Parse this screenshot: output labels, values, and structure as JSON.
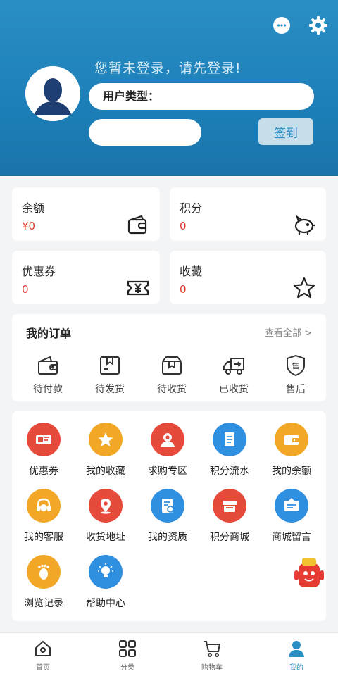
{
  "header": {
    "login_hint": "您暂未登录，请先登录!",
    "user_type_label": "用户类型：",
    "signin_label": "签到"
  },
  "stats": [
    {
      "title": "余额",
      "value": "¥0",
      "icon": "wallet-icon"
    },
    {
      "title": "积分",
      "value": "0",
      "icon": "piggy-bank-icon"
    },
    {
      "title": "优惠券",
      "value": "0",
      "icon": "ticket-icon"
    },
    {
      "title": "收藏",
      "value": "0",
      "icon": "star-icon"
    }
  ],
  "orders": {
    "title": "我的订单",
    "view_all": "查看全部 >",
    "items": [
      {
        "label": "待付款",
        "icon": "wallet-icon"
      },
      {
        "label": "待发货",
        "icon": "box-icon"
      },
      {
        "label": "待收货",
        "icon": "open-box-icon"
      },
      {
        "label": "已收货",
        "icon": "truck-icon"
      },
      {
        "label": "售后",
        "icon": "shield-icon"
      }
    ]
  },
  "services": [
    {
      "label": "优惠券",
      "icon": "coupon-icon",
      "color": "#e64a3a"
    },
    {
      "label": "我的收藏",
      "icon": "star-icon",
      "color": "#f2a826"
    },
    {
      "label": "求购专区",
      "icon": "person-icon",
      "color": "#e64a3a"
    },
    {
      "label": "积分流水",
      "icon": "list-icon",
      "color": "#2f8fe0"
    },
    {
      "label": "我的余额",
      "icon": "wallet-icon",
      "color": "#f2a826"
    },
    {
      "label": "我的客服",
      "icon": "headset-icon",
      "color": "#f2a826"
    },
    {
      "label": "收货地址",
      "icon": "location-icon",
      "color": "#e64a3a"
    },
    {
      "label": "我的资质",
      "icon": "document-icon",
      "color": "#2f8fe0"
    },
    {
      "label": "积分商城",
      "icon": "store-icon",
      "color": "#e64a3a"
    },
    {
      "label": "商城留言",
      "icon": "message-icon",
      "color": "#2f8fe0"
    },
    {
      "label": "浏览记录",
      "icon": "footprint-icon",
      "color": "#f2a826"
    },
    {
      "label": "帮助中心",
      "icon": "bulb-icon",
      "color": "#2f8fe0"
    }
  ],
  "tabbar": [
    {
      "label": "首页",
      "icon": "home-icon"
    },
    {
      "label": "分类",
      "icon": "grid-icon"
    },
    {
      "label": "购物车",
      "icon": "cart-icon"
    },
    {
      "label": "我的",
      "icon": "user-icon",
      "active": true
    }
  ],
  "colors": {
    "accent": "#2a8fc5",
    "red": "#e03a2f",
    "orange": "#f2a826",
    "blue": "#2f8fe0"
  }
}
